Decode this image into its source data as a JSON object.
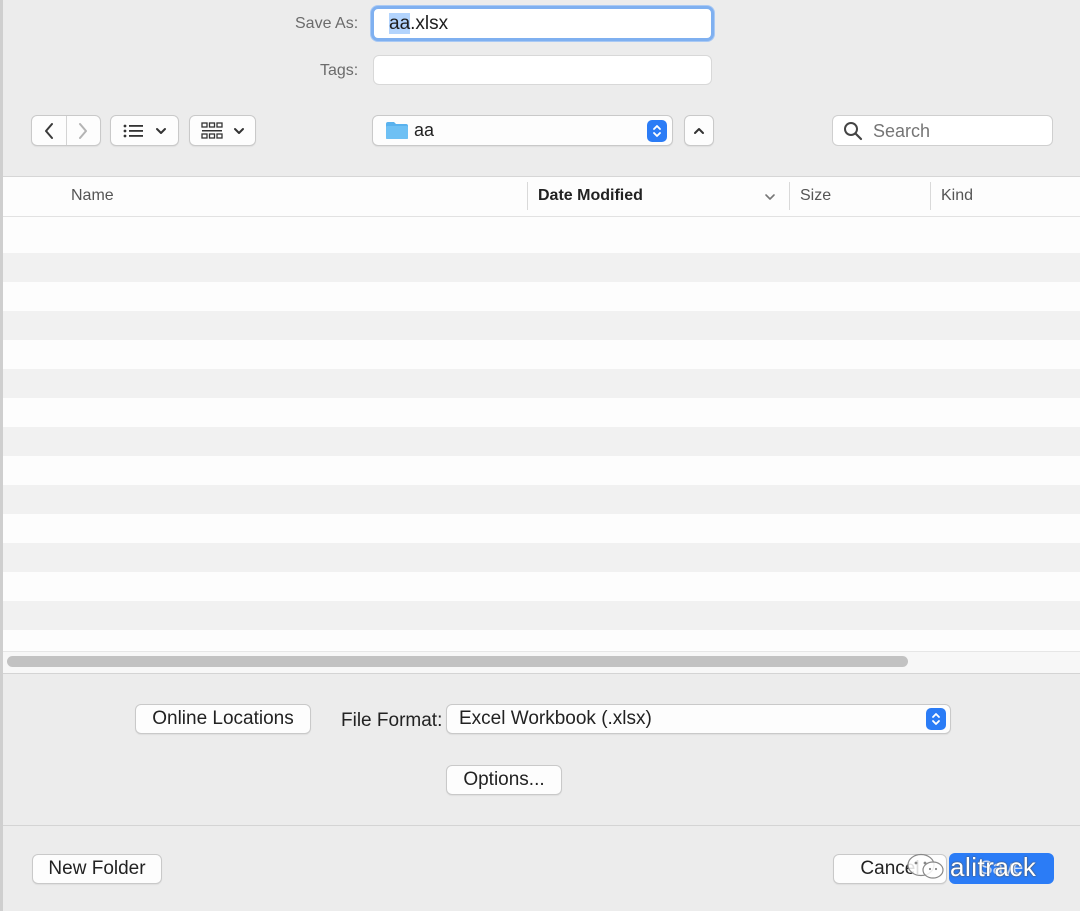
{
  "save_panel": {
    "save_as_label": "Save As:",
    "filename_selected": "aa",
    "filename_rest": ".xlsx",
    "tags_label": "Tags:",
    "tags_value": ""
  },
  "toolbar": {
    "back_icon": "chevron-left-icon",
    "forward_icon": "chevron-right-icon",
    "list_view_icon": "list-icon",
    "grid_view_icon": "grid-icon",
    "location_name": "aa",
    "search_placeholder": "Search",
    "accent_color": "#2b7cf6",
    "folder_color": "#59b2ee"
  },
  "file_list": {
    "columns": [
      "Name",
      "Date Modified",
      "Size",
      "Kind"
    ],
    "sorted_column": "Date Modified",
    "rows": []
  },
  "options": {
    "online_locations_label": "Online Locations",
    "file_format_label": "File Format:",
    "file_format_value": "Excel Workbook (.xlsx)",
    "options_button_label": "Options..."
  },
  "footer": {
    "new_folder_label": "New Folder",
    "cancel_label": "Cancel",
    "save_label": "Save",
    "watermark_text": "alitrack"
  }
}
